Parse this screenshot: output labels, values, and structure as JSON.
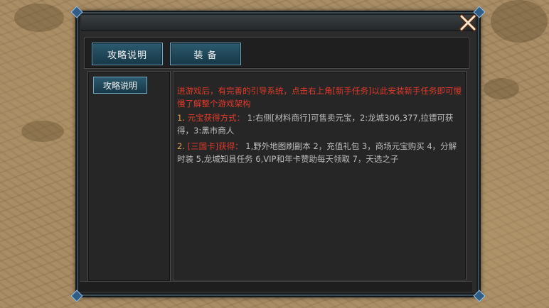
{
  "window": {
    "close_icon": "close-x-icon",
    "accent": "#e03a2a",
    "tab_color": "#2b5a6e"
  },
  "tabs": [
    {
      "label": "攻略说明"
    },
    {
      "label": "装 备"
    }
  ],
  "sidebar": {
    "items": [
      {
        "label": "攻略说明"
      }
    ]
  },
  "content": {
    "intro": "进游戏后，有完善的引导系统，点击右上角[新手任务]以此安装新手任务即可慢慢了解整个游戏架构",
    "sections": [
      {
        "num": "1.",
        "label": "元宝获得方式：",
        "body": "1:右侧[材料商行]可售卖元宝，2:龙城306,377,拉镖可获得，3:黑市商人"
      },
      {
        "num": "2.",
        "label": "[三国卡]获得：",
        "body": "1,野外地图刷副本 2，充值礼包 3，商场元宝购买 4，分解时装 5,龙城知县任务 6,VIP和年卡赞助每天领取 7，天选之子"
      }
    ]
  }
}
